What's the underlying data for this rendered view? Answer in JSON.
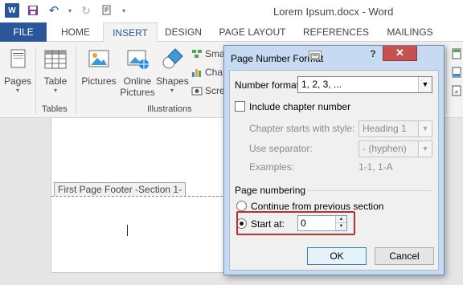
{
  "titlebar": {
    "app_icon": "word-icon",
    "app_icon_letter": "W",
    "doc_title": "Lorem Ipsum.docx - Word"
  },
  "tabs": [
    {
      "label": "FILE"
    },
    {
      "label": "HOME"
    },
    {
      "label": "INSERT"
    },
    {
      "label": "DESIGN"
    },
    {
      "label": "PAGE LAYOUT"
    },
    {
      "label": "REFERENCES"
    },
    {
      "label": "MAILINGS"
    }
  ],
  "ribbon": {
    "pages_label": "Pages",
    "table_label": "Table",
    "tables_group": "Tables",
    "pictures_label": "Pictures",
    "online_pictures_label_1": "Online",
    "online_pictures_label_2": "Pictures",
    "shapes_label": "Shapes",
    "illustrations_group": "Illustrations",
    "smartart_partial": "Sma",
    "chart_partial": "Cha",
    "screenshot_partial": "Scre"
  },
  "document": {
    "footer_label": "First Page Footer -Section 1-"
  },
  "dialog": {
    "title": "Page Number Format",
    "close_label": "✕",
    "help_label": "?",
    "number_format_label": "Number format:",
    "number_format_value": "1, 2, 3, ...",
    "include_chapter_label": "Include chapter number",
    "chapter_style_label": "Chapter starts with style:",
    "chapter_style_value": "Heading 1",
    "separator_label": "Use separator:",
    "separator_value": "-   (hyphen)",
    "examples_label": "Examples:",
    "examples_value": "1-1, 1-A",
    "page_numbering_label": "Page numbering",
    "continue_label": "Continue from previous section",
    "start_at_label": "Start at:",
    "start_at_value": "0",
    "ok_label": "OK",
    "cancel_label": "Cancel"
  },
  "colors": {
    "accent": "#2b579a",
    "highlight": "#b8302e"
  }
}
